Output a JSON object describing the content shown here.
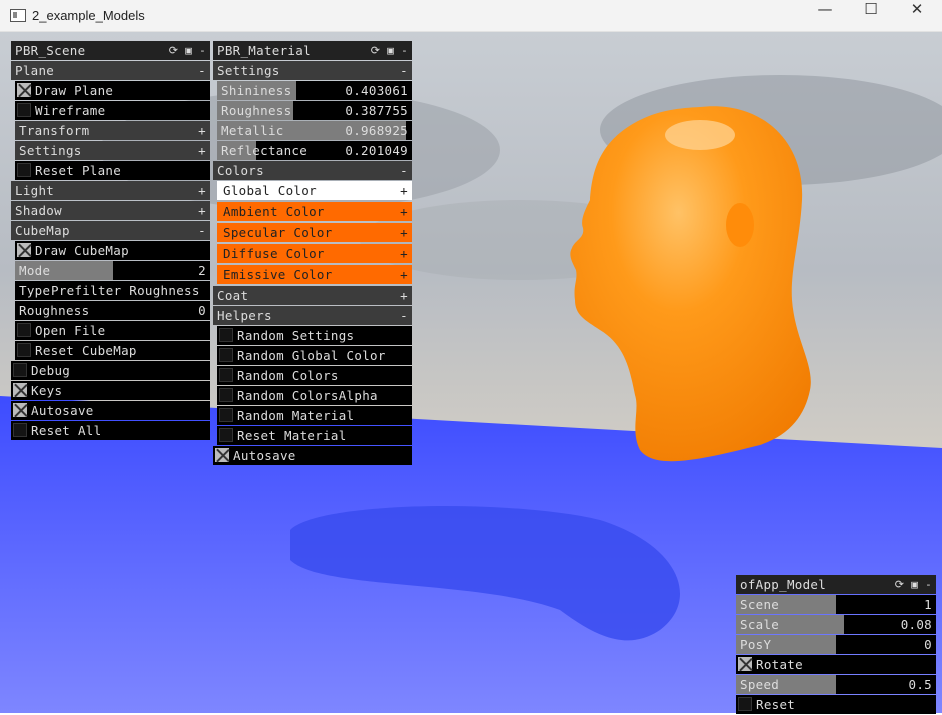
{
  "window": {
    "title": "2_example_Models",
    "minimize": "—",
    "maximize": "☐",
    "close": "✕"
  },
  "colors": {
    "accent_orange": "#ff6a00",
    "floor_blue": "#5a66ff"
  },
  "pbr_scene": {
    "title": "PBR_Scene",
    "tools": "⟳ ▣ -",
    "plane_label": "Plane",
    "draw_plane": "Draw Plane",
    "wireframe": "Wireframe",
    "transform": "Transform",
    "settings": "Settings",
    "reset_plane": "Reset Plane",
    "light": "Light",
    "shadow": "Shadow",
    "cubemap": "CubeMap",
    "draw_cubemap": "Draw CubeMap",
    "mode_label": "Mode",
    "mode_value": "2",
    "mode_fraction": 0.5,
    "type_label": "Type",
    "type_value": "Prefilter Roughness",
    "roughness_label": "Roughness",
    "roughness_value": "0",
    "open_file": "Open File",
    "reset_cubemap": "Reset CubeMap",
    "debug": "Debug",
    "keys": "Keys",
    "autosave": "Autosave",
    "reset_all": "Reset All",
    "plus": "+",
    "minus": "-"
  },
  "pbr_material": {
    "title": "PBR_Material",
    "tools": "⟳ ▣ -",
    "settings": "Settings",
    "sliders": [
      {
        "label": "Shininess",
        "value": "0.403061",
        "fraction": 0.403061
      },
      {
        "label": "Roughness",
        "value": "0.387755",
        "fraction": 0.387755
      },
      {
        "label": "Metallic",
        "value": "0.968925",
        "fraction": 0.968925
      },
      {
        "label": "Reflectance",
        "value": "0.201049",
        "fraction": 0.201049
      }
    ],
    "colors_label": "Colors",
    "color_items": [
      {
        "label": "Global Color",
        "color": "#ffffff"
      },
      {
        "label": "Ambient Color",
        "color": "#ff6a00"
      },
      {
        "label": "Specular Color",
        "color": "#ff6a00"
      },
      {
        "label": "Diffuse Color",
        "color": "#ff6a00"
      },
      {
        "label": "Emissive Color",
        "color": "#ff6a00"
      }
    ],
    "coat": "Coat",
    "helpers": "Helpers",
    "helper_items": [
      "Random Settings",
      "Random Global Color",
      "Random Colors",
      "Random ColorsAlpha",
      "Random Material",
      "Reset Material"
    ],
    "autosave": "Autosave",
    "plus": "+",
    "minus": "-"
  },
  "ofapp_model": {
    "title": "ofApp_Model",
    "tools": "⟳ ▣ -",
    "scene_label": "Scene",
    "scene_value": "1",
    "scene_fraction": 0.5,
    "scale_label": "Scale",
    "scale_value": "0.08",
    "scale_fraction": 0.54,
    "posy_label": "PosY",
    "posy_value": "0",
    "posy_fraction": 0.5,
    "rotate": "Rotate",
    "speed_label": "Speed",
    "speed_value": "0.5",
    "speed_fraction": 0.5,
    "reset": "Reset"
  }
}
